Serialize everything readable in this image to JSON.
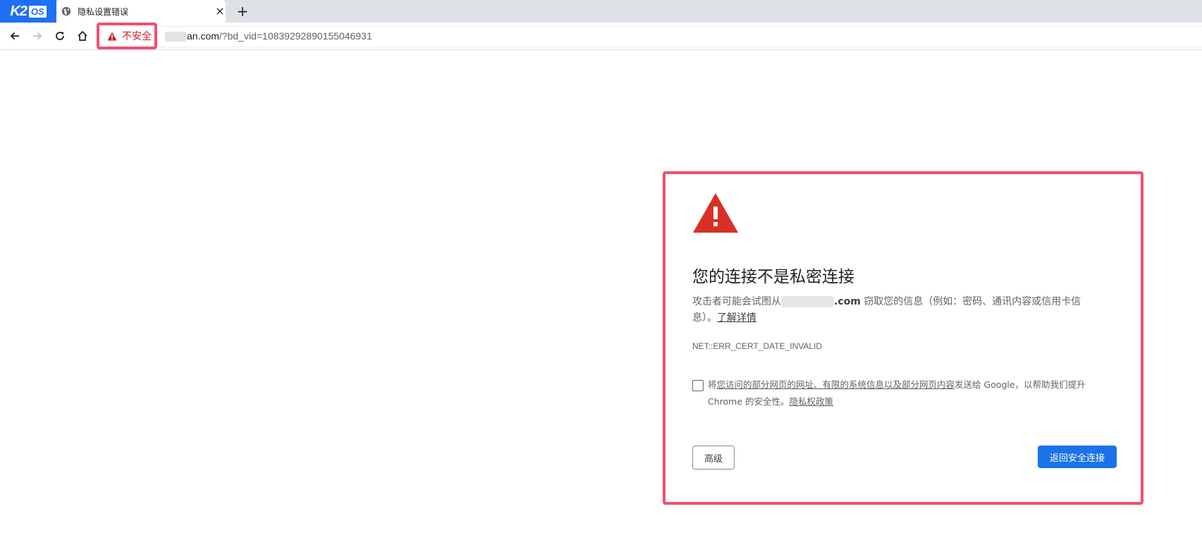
{
  "browser": {
    "logo": {
      "main": "K2",
      "badge": "OS"
    },
    "tab": {
      "title": "隐私设置错误",
      "favicon": "globe-icon",
      "close": "×"
    },
    "new_tab": "+",
    "nav": {
      "back": "back-arrow-icon",
      "forward": "forward-arrow-icon",
      "reload": "reload-icon",
      "home": "home-icon"
    },
    "security_chip": {
      "icon": "warning-triangle-icon",
      "label": "不安全",
      "color": "#c5221f"
    },
    "url": {
      "host": "an.com",
      "path": "/?bd_vid=10839292890155046931"
    }
  },
  "interstitial": {
    "icon": "large-warning-triangle-icon",
    "icon_color": "#d93025",
    "heading": "您的连接不是私密连接",
    "description": {
      "prefix": "攻击者可能会试图从",
      "domain": ".com",
      "suffix": "窃取您的信息（例如：密码、通讯内容或信用卡信息）。",
      "learn_more": "了解详情"
    },
    "error_code": "NET::ERR_CERT_DATE_INVALID",
    "optin": {
      "pre": "将",
      "link1": "您访问的部分网页的网址、有限的系统信息以及部分网页内容",
      "mid": "发送给 Google，以帮助我们提升 Chrome 的安全性。",
      "privacy_link": "隐私权政策",
      "checked": false
    },
    "advanced_button": "高级",
    "back_button": "返回安全连接",
    "accent_color": "#1a73e8",
    "highlight_color": "#f0506e"
  }
}
